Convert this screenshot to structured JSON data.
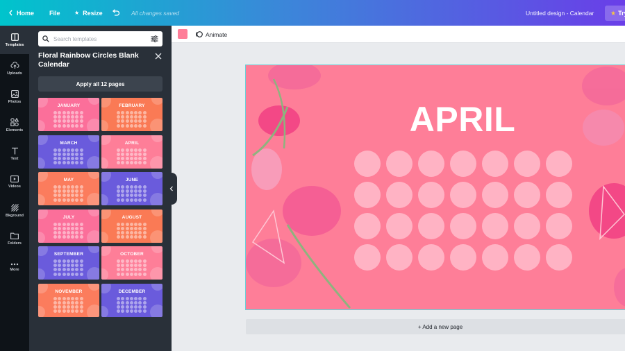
{
  "topbar": {
    "home": "Home",
    "file": "File",
    "resize": "Resize",
    "saved_status": "All changes saved",
    "design_title": "Untitled design - Calendar",
    "try_label": "Try"
  },
  "rail": {
    "items": [
      {
        "label": "Templates",
        "icon": "templates-icon"
      },
      {
        "label": "Uploads",
        "icon": "upload-cloud-icon"
      },
      {
        "label": "Photos",
        "icon": "image-icon"
      },
      {
        "label": "Elements",
        "icon": "shapes-icon"
      },
      {
        "label": "Text",
        "icon": "text-icon"
      },
      {
        "label": "Videos",
        "icon": "video-icon"
      },
      {
        "label": "Bkground",
        "icon": "background-icon"
      },
      {
        "label": "Folders",
        "icon": "folder-icon"
      },
      {
        "label": "More",
        "icon": "more-icon"
      }
    ]
  },
  "panel": {
    "search_placeholder": "Search templates",
    "title": "Floral Rainbow Circles Blank Calendar",
    "apply_label": "Apply all 12 pages",
    "templates": [
      {
        "month": "JANUARY",
        "color": "#fb6f9a"
      },
      {
        "month": "FEBRUARY",
        "color": "#fa7a55"
      },
      {
        "month": "MARCH",
        "color": "#6a5bdc"
      },
      {
        "month": "APRIL",
        "color": "#fe7e98"
      },
      {
        "month": "MAY",
        "color": "#fb7c5d"
      },
      {
        "month": "JUNE",
        "color": "#6a5bdc"
      },
      {
        "month": "JULY",
        "color": "#fb6f9a"
      },
      {
        "month": "AUGUST",
        "color": "#fa7a55"
      },
      {
        "month": "SEPTEMBER",
        "color": "#6a5bdc"
      },
      {
        "month": "OCTOBER",
        "color": "#fe7e98"
      },
      {
        "month": "NOVEMBER",
        "color": "#fb7c5d"
      },
      {
        "month": "DECEMBER",
        "color": "#6a5bdc"
      }
    ]
  },
  "editor": {
    "swatch_color": "#fe7e98",
    "animate_label": "Animate",
    "month_title": "APRIL",
    "add_page_label": "+ Add a new page",
    "canvas_color": "#fe7e98",
    "circle_color": "#ffb3c4",
    "circle_rows": 4,
    "circle_cols": 7
  }
}
